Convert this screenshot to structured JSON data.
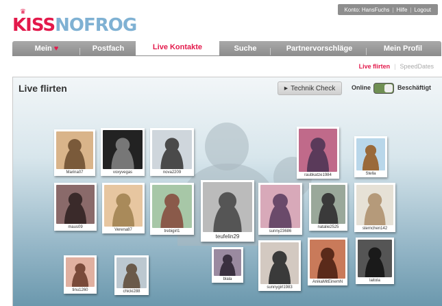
{
  "account": {
    "konto": "Konto: HansFuchs",
    "hilfe": "Hilfe",
    "logout": "Logout"
  },
  "logo": {
    "part1": "KISS",
    "part2": "NOFROG"
  },
  "nav": {
    "tabs": [
      "Mein",
      "Postfach",
      "Live Kontakte",
      "Suche",
      "Partnervorschläge",
      "Mein Profil"
    ]
  },
  "subnav": {
    "active": "Live flirten",
    "other": "SpeedDates"
  },
  "panel": {
    "title": "Live flirten",
    "technik": "Technik Check",
    "online": "Online",
    "busy": "Beschäftigt"
  },
  "colors": {
    "brand": "#e3194b",
    "logo_blue": "#7fb1d3",
    "nav_gray": "#9b9b9b",
    "toggle_green": "#6f8f53"
  },
  "users": [
    "Marina07",
    "voxyvegas",
    "nova2209",
    "raubkatze1984",
    "Stella",
    "maus09",
    "Verena87",
    "trebigirl1",
    "teufelin29",
    "sunny23686",
    "natalie2525",
    "sternchen142",
    "tinu1260",
    "chicki288",
    "blala",
    "sunnygirl1983",
    "AnikaMitEinemN",
    "laitola"
  ]
}
